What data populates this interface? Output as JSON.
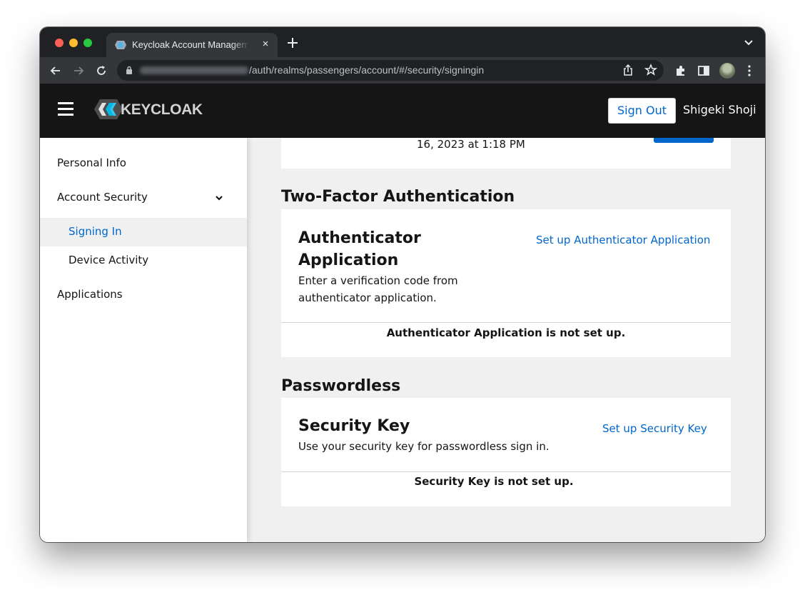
{
  "browser": {
    "tab_title": "Keycloak Account Management",
    "tab_close": "×",
    "url_path": "/auth/realms/passengers/account/#/security/signingin"
  },
  "header": {
    "logo_text": "KEYCLOAK",
    "sign_out_label": "Sign Out",
    "user_name": "Shigeki Shoji"
  },
  "sidebar": {
    "items": [
      {
        "label": "Personal Info"
      },
      {
        "label": "Account Security"
      },
      {
        "label": "Signing In"
      },
      {
        "label": "Device Activity"
      },
      {
        "label": "Applications"
      }
    ]
  },
  "main": {
    "top_card_date": "16, 2023 at 1:18 PM",
    "two_factor": {
      "section_title": "Two-Factor Authentication",
      "card_title": "Authenticator Application",
      "description": "Enter a verification code from authenticator application.",
      "setup_link": "Set up Authenticator Application",
      "status": "Authenticator Application is not set up."
    },
    "passwordless": {
      "section_title": "Passwordless",
      "card_title": "Security Key",
      "description": "Use your security key for passwordless sign in.",
      "setup_link": "Set up Security Key",
      "status": "Security Key is not set up."
    }
  },
  "colors": {
    "accent": "#0066cc",
    "header_bg": "#151515",
    "content_bg": "#f0f0f0"
  }
}
